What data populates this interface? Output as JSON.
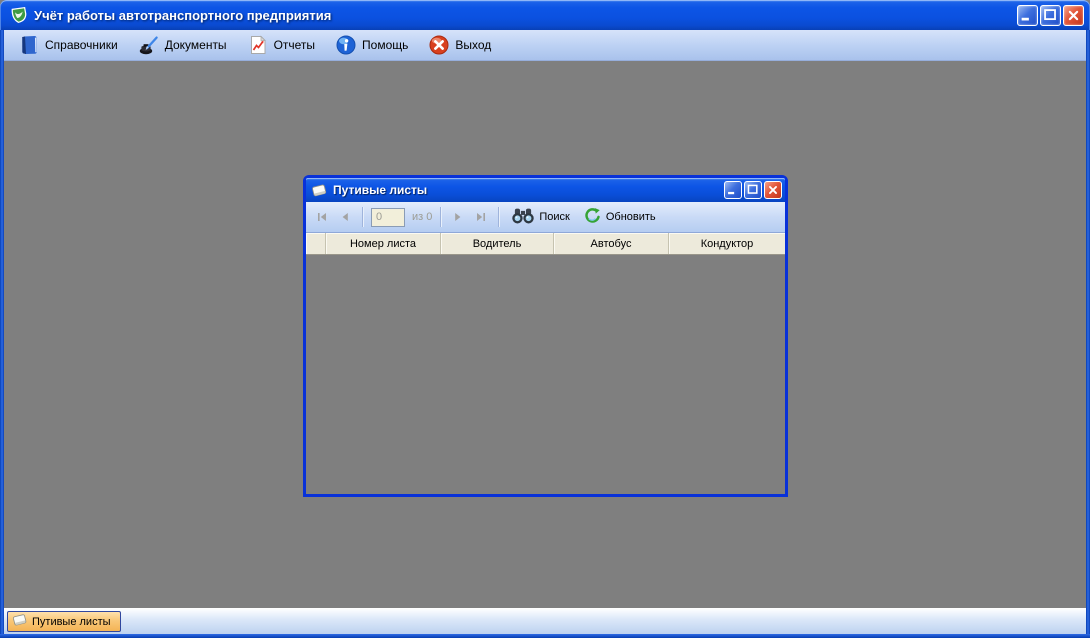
{
  "main_window": {
    "title": "Учёт работы автотранспортного предприятия"
  },
  "menubar": {
    "items": [
      {
        "label": "Справочники",
        "icon": "book-icon"
      },
      {
        "label": "Документы",
        "icon": "ink-pen-icon"
      },
      {
        "label": "Отчеты",
        "icon": "report-icon"
      },
      {
        "label": "Помощь",
        "icon": "help-icon"
      },
      {
        "label": "Выход",
        "icon": "exit-icon"
      }
    ]
  },
  "waybills_window": {
    "title": "Путивые листы",
    "toolbar": {
      "record_number": "0",
      "record_total_label": "из 0",
      "search_label": "Поиск",
      "refresh_label": "Обновить"
    },
    "table": {
      "columns": [
        "Номер листа",
        "Водитель",
        "Автобус",
        "Кондуктор"
      ],
      "rows": []
    }
  },
  "taskbar": {
    "items": [
      {
        "label": "Путивые листы",
        "icon": "note-icon",
        "active": true
      }
    ]
  },
  "colors": {
    "titlebar_blue": "#0B51E0",
    "window_border_blue": "#0831D9",
    "client_gray": "#7F7F7F",
    "toolbar_blue": "#BBD0F3",
    "grid_header_beige": "#EDEADB",
    "taskbar_button_orange": "#F9C778",
    "close_button_red": "#E3573A"
  }
}
